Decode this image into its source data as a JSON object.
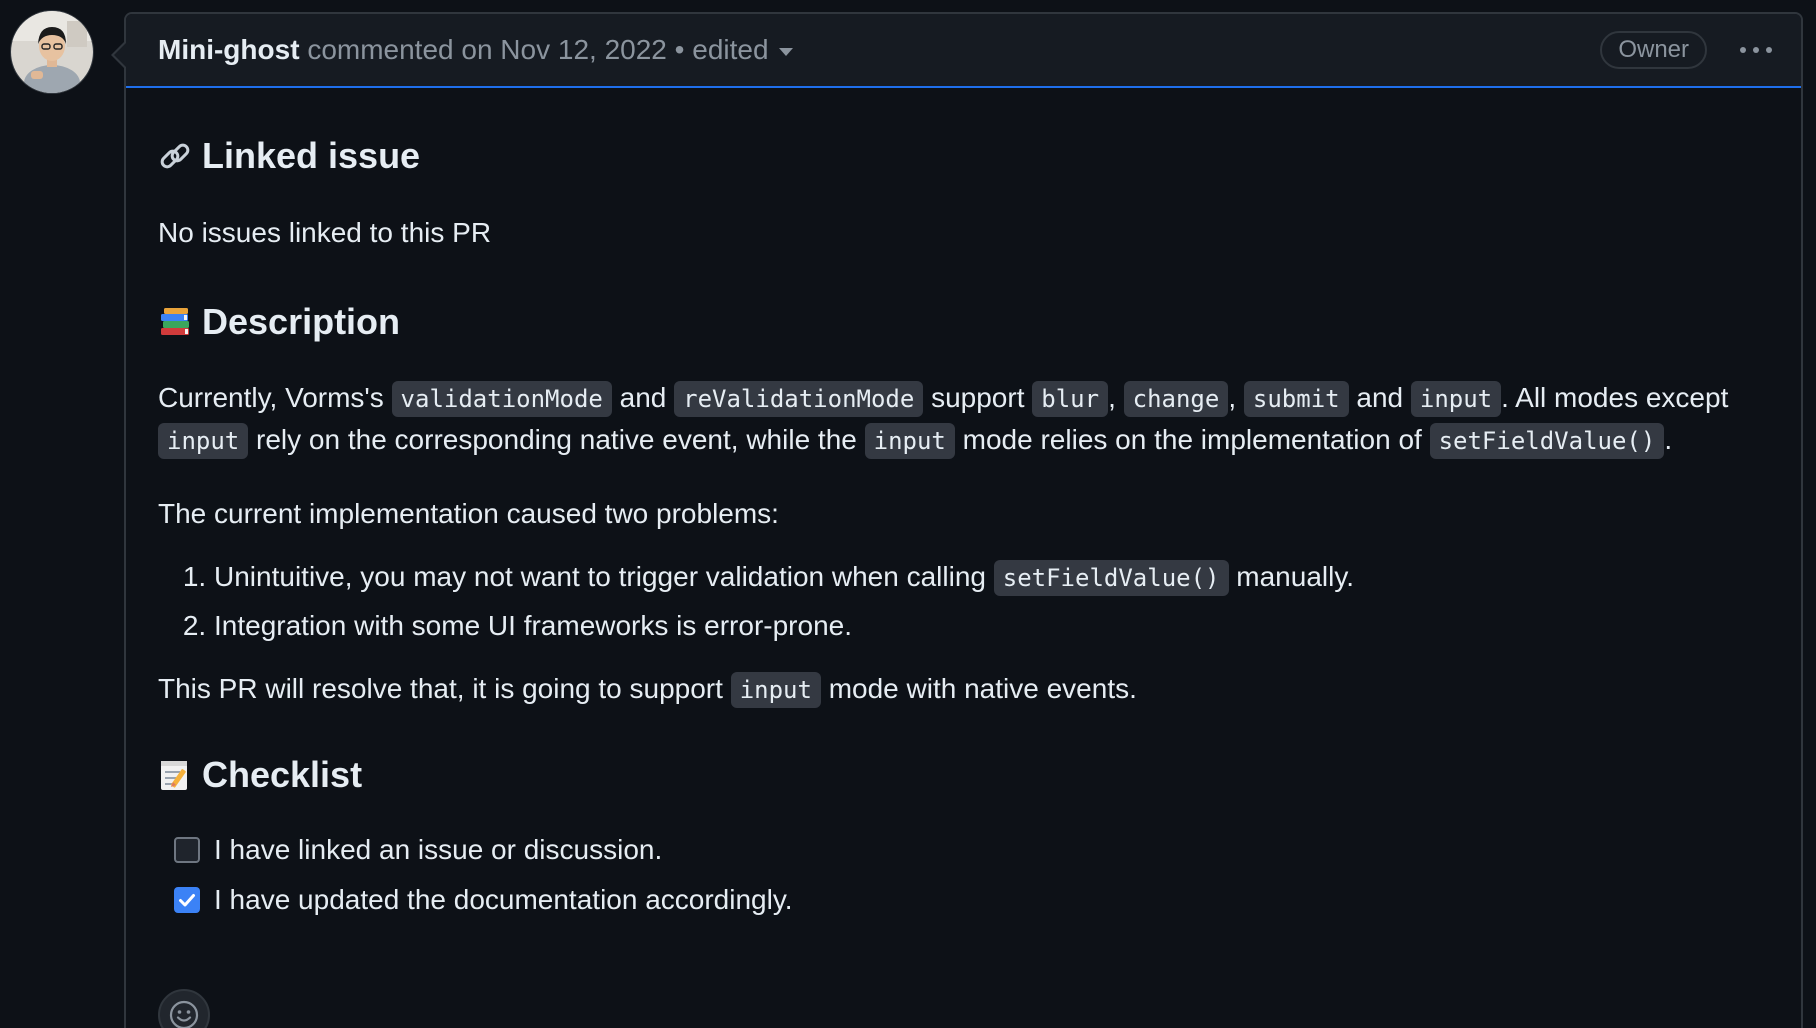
{
  "comment": {
    "author": "Mini-ghost",
    "meta": "commented on Nov 12, 2022",
    "separator": "•",
    "edited": "edited",
    "badge": "Owner"
  },
  "body": {
    "linked_heading": "Linked issue",
    "linked_text": "No issues linked to this PR",
    "desc_heading": "Description",
    "desc": {
      "t1": "Currently, Vorms's ",
      "c1": "validationMode",
      "t2": " and ",
      "c2": "reValidationMode",
      "t3": " support ",
      "c3": "blur",
      "t4": ", ",
      "c4": "change",
      "t5": ", ",
      "c5": "submit",
      "t6": " and ",
      "c6": "input",
      "t7": ". All modes except",
      "c7": "input",
      "t8": " rely on the corresponding native event, while the ",
      "c8": "input",
      "t9": " mode relies on the implementation of ",
      "c9": "setFieldValue()",
      "t10": "."
    },
    "problems_intro": "The current implementation caused two problems:",
    "problems": [
      {
        "t1": "Unintuitive, you may not want to trigger validation when calling ",
        "code": "setFieldValue()",
        "t2": " manually."
      },
      {
        "t1": "Integration with some UI frameworks is error-prone."
      }
    ],
    "resolve": {
      "t1": "This PR will resolve that, it is going to support ",
      "code": "input",
      "t2": " mode with native events."
    },
    "checklist_heading": "Checklist",
    "checklist": [
      {
        "label": "I have linked an issue or discussion.",
        "checked": false
      },
      {
        "label": "I have updated the documentation accordingly.",
        "checked": true
      }
    ]
  },
  "icons": {
    "kebab": "kebab-horizontal-icon",
    "caret": "caret-down-icon",
    "reaction": "smiley-icon",
    "linked": "link-emoji",
    "description": "books-emoji",
    "checklist": "memo-emoji"
  },
  "colors": {
    "background": "#0d1117",
    "header_bg": "#161b22",
    "border": "#30363d",
    "accent_border": "#1f6feb",
    "code_bg": "#343942",
    "checkbox_checked": "#3b82f6",
    "muted_text": "#8b949e",
    "text": "#e6edf3"
  }
}
